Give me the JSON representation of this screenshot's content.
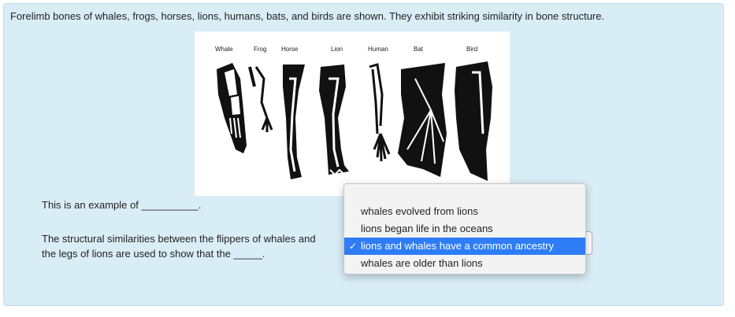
{
  "question": {
    "intro": "Forelimb bones of whales, frogs, horses, lions, humans, bats, and birds are shown. They exhibit striking similarity in bone structure.",
    "part1": "This is an example of __________.",
    "part2_line1": "The structural similarities between the flippers of whales and",
    "part2_line2": "the legs of lions are used to show that the _____."
  },
  "figure": {
    "labels": [
      "Whale",
      "Frog",
      "Horse",
      "Lion",
      "Human",
      "Bat",
      "Bird"
    ]
  },
  "dropdown": {
    "options": [
      "whales evolved from lions",
      "lions began life in the oceans",
      "lions and whales have a common ancestry",
      "whales are older than lions"
    ],
    "selected_index": 2,
    "checkmark": "✓",
    "highlight_color": "#2f7df6"
  }
}
